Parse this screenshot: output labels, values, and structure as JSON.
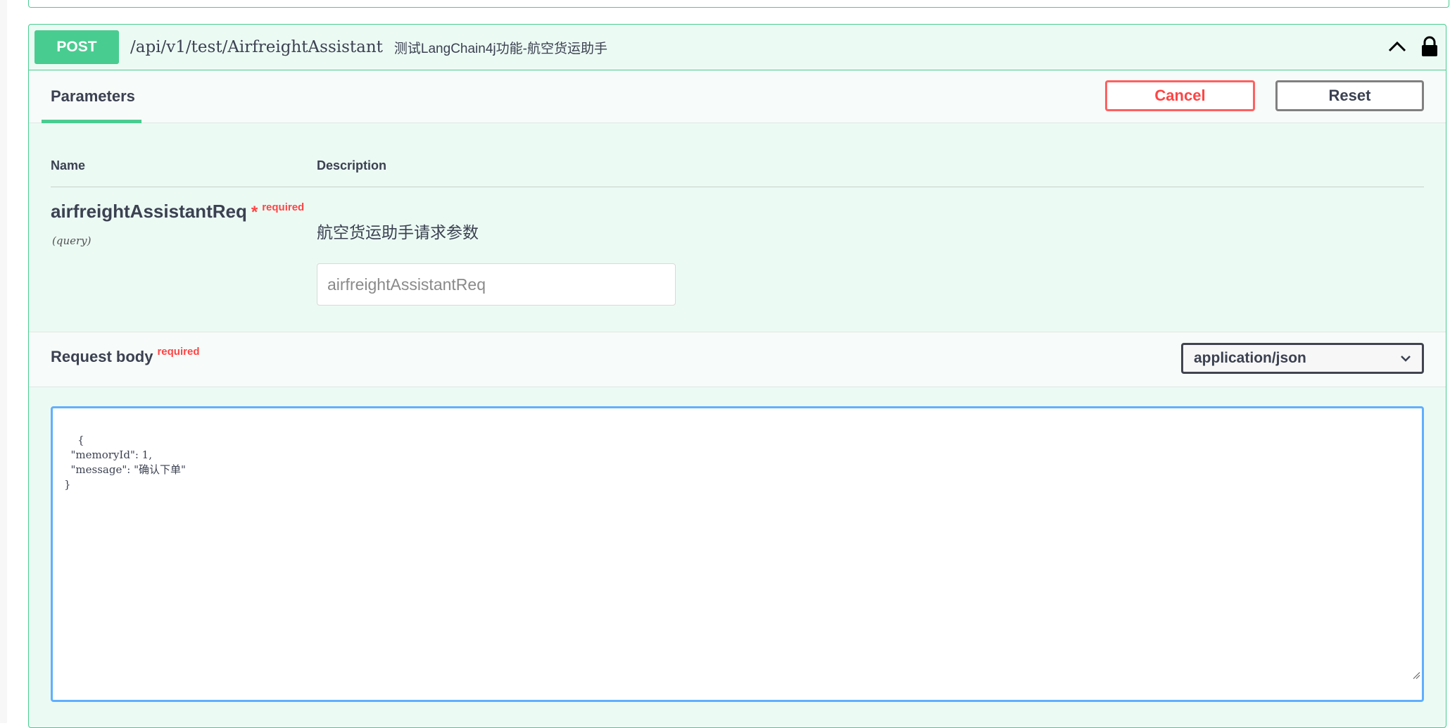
{
  "operation": {
    "method": "POST",
    "path": "/api/v1/test/AirfreightAssistant",
    "summary": "测试LangChain4j功能-航空货运助手"
  },
  "tabs": {
    "parameters": "Parameters"
  },
  "buttons": {
    "cancel": "Cancel",
    "reset": "Reset"
  },
  "table": {
    "col_name": "Name",
    "col_description": "Description"
  },
  "parameter": {
    "name": "airfreightAssistantReq",
    "star": "*",
    "required_label": "required",
    "in": "(query)",
    "description": "航空货运助手请求参数",
    "placeholder": "airfreightAssistantReq"
  },
  "request_body": {
    "title": "Request body",
    "required_label": "required",
    "content_type": "application/json",
    "json_text": "{\n  \"memoryId\": 1,\n  \"message\": \"确认下单\"\n}"
  },
  "colors": {
    "post": "#49cc90",
    "required": "#ff4444",
    "focus": "#61affe"
  },
  "icons": {
    "collapse": "chevron-up-icon",
    "auth": "lock-icon",
    "select": "chevron-down-icon"
  }
}
